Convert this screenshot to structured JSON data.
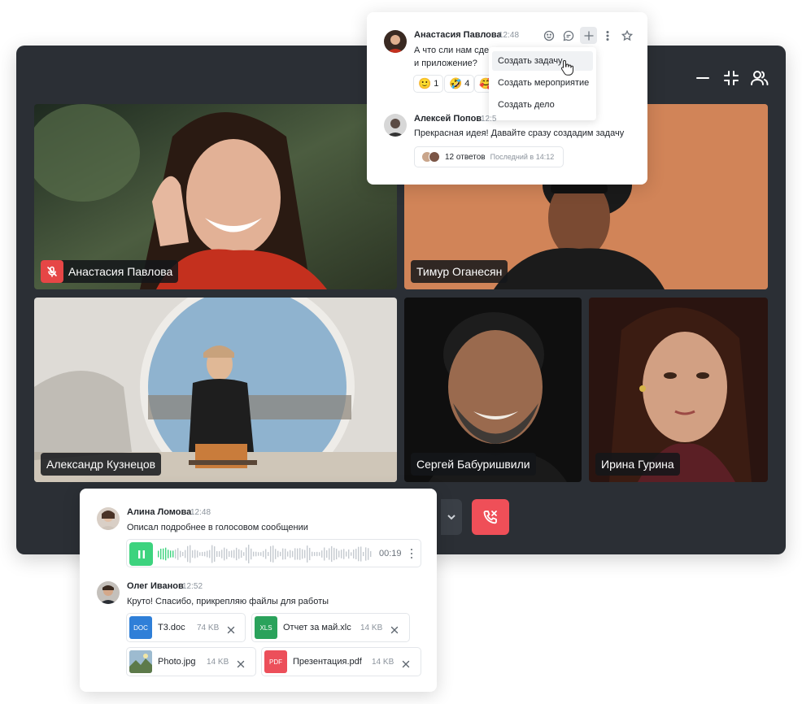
{
  "colors": {
    "window_bg": "#2b2f35",
    "accent_red": "#ef4f58",
    "accent_green": "#3dd37e",
    "doc_blue": "#2f7fd8",
    "xls_green": "#2aa25b",
    "pdf_red": "#ec4f5a"
  },
  "window_controls": {
    "icons": [
      "minimize-icon",
      "collapse-icon",
      "participants-icon"
    ]
  },
  "participants": [
    {
      "name": "Анастасия Павлова",
      "muted": true
    },
    {
      "name": "Тимур Оганесян",
      "muted": false
    },
    {
      "name": "Александр Кузнецов",
      "muted": false
    },
    {
      "name": "Сергей Бабуришвили",
      "muted": false
    },
    {
      "name": "Ирина Гурина",
      "muted": false
    }
  ],
  "call_controls": {
    "icons": [
      "chevron-down-icon",
      "hangup-icon"
    ]
  },
  "chat_top": {
    "message1": {
      "author": "Анастасия Павлова",
      "time": "12:48",
      "text_line1": "А что сли нам сдел",
      "text_line2": "и приложение?",
      "reactions": [
        {
          "emoji": "🙂",
          "count": "1"
        },
        {
          "emoji": "🤣",
          "count": "4"
        },
        {
          "emoji": "🥰",
          "count": ""
        }
      ]
    },
    "toolbar_icons": [
      "smile-icon",
      "comment-icon",
      "plus-icon",
      "more-vertical-icon",
      "star-icon"
    ],
    "menu_items": [
      "Создать задачу",
      "Создать мероприятие",
      "Создать дело"
    ],
    "message2": {
      "author": "Алексей Попов",
      "time": "12:5",
      "text": "Прекрасная идея! Давайте сразу создадим задачу",
      "thread_count": "12 ответов",
      "thread_last": "Последний в 14:12"
    }
  },
  "chat_bottom": {
    "message1": {
      "author": "Алина Ломова",
      "time": "12:48",
      "text": "Описал подробнее в голосовом сообщении",
      "voice_duration": "00:19"
    },
    "message2": {
      "author": "Олег Иванов",
      "time": "12:52",
      "text": "Круто! Спасибо, прикрепляю файлы для работы"
    },
    "files": [
      {
        "badge": "DOC",
        "name": "Т3.doc",
        "size": "74 KB"
      },
      {
        "badge": "XLS",
        "name": "Отчет за май.xlc",
        "size": "14 KB"
      },
      {
        "badge": "",
        "name": "Photo.jpg",
        "size": "14 KB"
      },
      {
        "badge": "PDF",
        "name": "Презентация.pdf",
        "size": "14 KB"
      }
    ]
  }
}
